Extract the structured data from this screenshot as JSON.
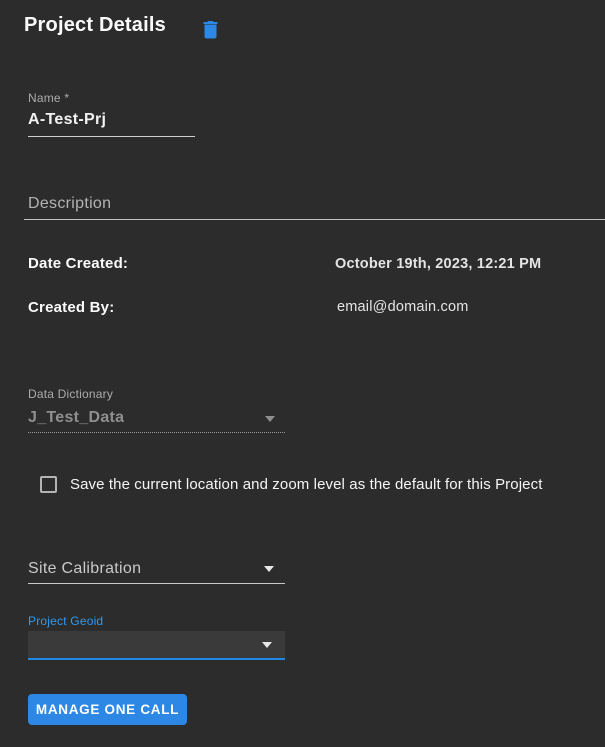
{
  "header": {
    "title": "Project Details"
  },
  "name_field": {
    "label": "Name *",
    "value": "A-Test-Prj"
  },
  "description_field": {
    "label": "Description",
    "value": ""
  },
  "info": {
    "date_created": {
      "label": "Date Created:",
      "value": "October 19th, 2023, 12:21 PM"
    },
    "created_by": {
      "label": "Created By:",
      "value": "email@domain.com"
    }
  },
  "data_dictionary": {
    "label": "Data Dictionary",
    "value": "J_Test_Data",
    "disabled": true
  },
  "save_default": {
    "label": "Save the current location and zoom level as the default for this Project",
    "checked": false
  },
  "site_calibration": {
    "label": "Site Calibration"
  },
  "project_geoid": {
    "label": "Project Geoid",
    "value": ""
  },
  "buttons": {
    "manage_one_call": "MANAGE ONE CALL"
  },
  "colors": {
    "background": "#2c2c2c",
    "accent_blue": "#1e88e5",
    "label_blue": "#2e9bf0",
    "button_blue": "#2d87e4",
    "text_primary": "#fafafa",
    "text_secondary": "#ababab",
    "text_disabled": "#8f8f8f"
  }
}
